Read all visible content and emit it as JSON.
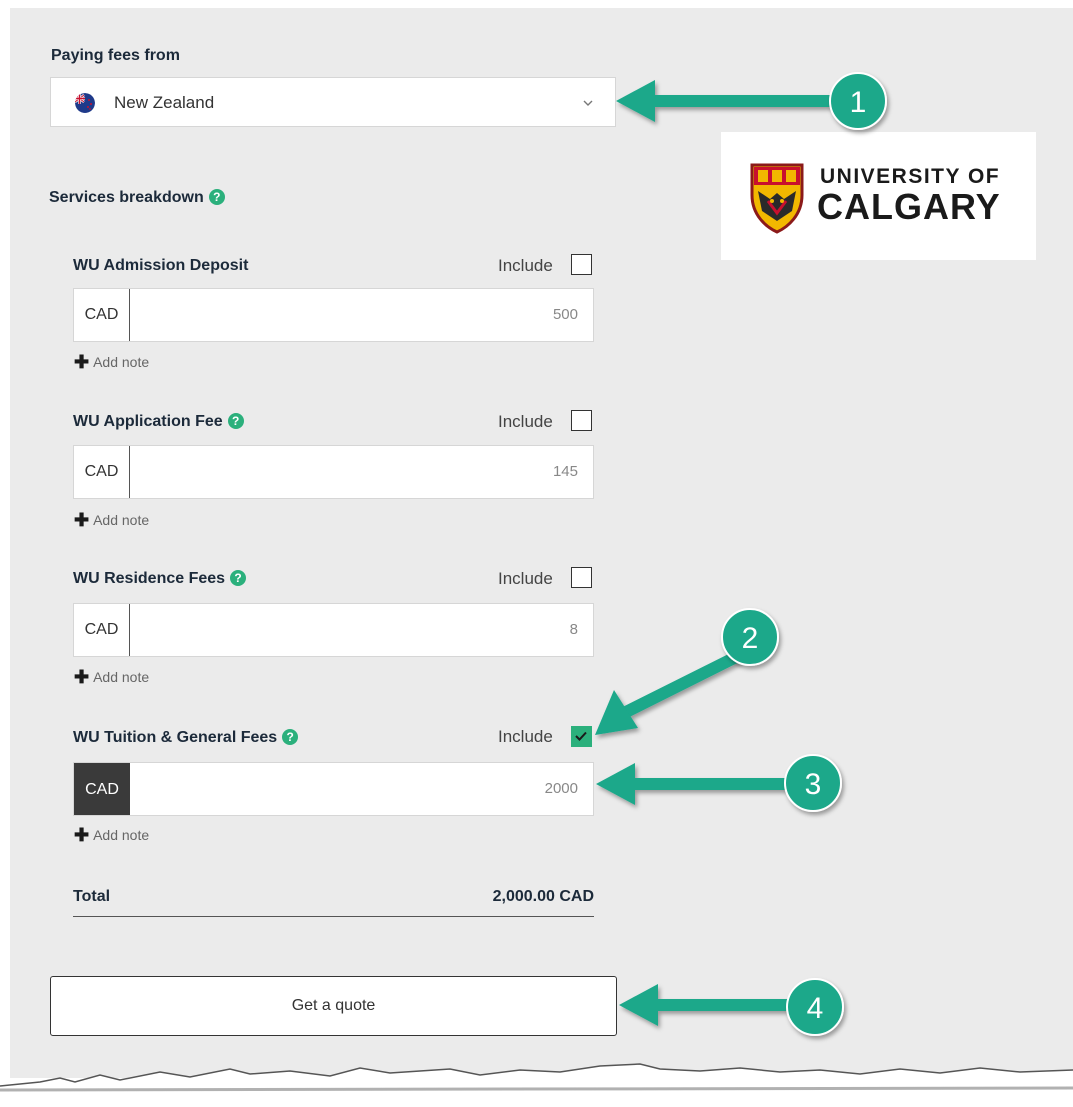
{
  "form": {
    "paying_label": "Paying fees from",
    "country": "New Zealand",
    "services_label": "Services breakdown",
    "help_glyph": "?",
    "include_label": "Include",
    "add_note_label": "Add note",
    "currency": "CAD",
    "services": [
      {
        "name": "WU Admission Deposit",
        "amount": "500",
        "included": false,
        "help": false
      },
      {
        "name": "WU Application Fee",
        "amount": "145",
        "included": false,
        "help": true
      },
      {
        "name": "WU Residence Fees",
        "amount": "8",
        "included": false,
        "help": true
      },
      {
        "name": "WU Tuition & General Fees",
        "amount": "2000",
        "included": true,
        "help": true
      }
    ],
    "total_label": "Total",
    "total_value": "2,000.00 CAD",
    "quote_button": "Get a quote"
  },
  "logo": {
    "line1": "UNIVERSITY OF",
    "line2": "CALGARY"
  },
  "annotations": [
    "1",
    "2",
    "3",
    "4"
  ],
  "colors": {
    "accent": "#2bb07c",
    "arrow": "#1aa88a",
    "panel": "#ebebeb",
    "text": "#1c2a3a"
  }
}
